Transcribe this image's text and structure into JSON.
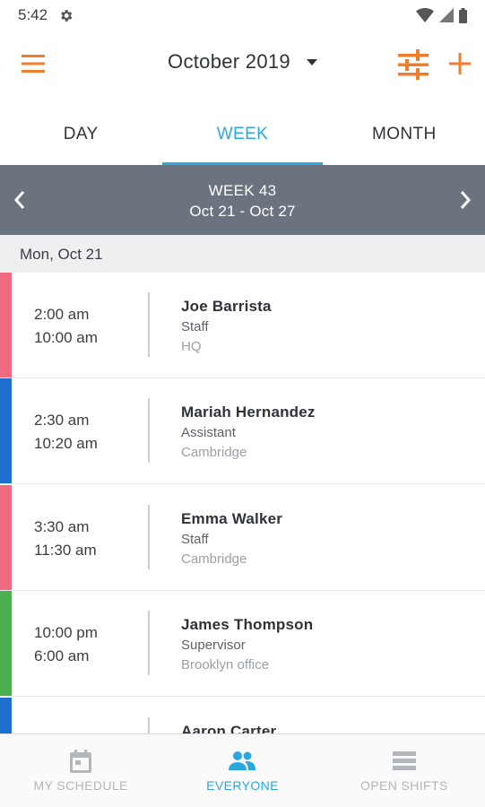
{
  "status_bar": {
    "time": "5:42",
    "icons": [
      "gear-icon",
      "wifi-icon",
      "signal-icon",
      "battery-icon"
    ]
  },
  "app_bar": {
    "menu_icon": "hamburger-menu-icon",
    "month": "October 2019",
    "caret_icon": "caret-down-icon",
    "filter_icon": "sliders-filter-icon",
    "add_icon": "plus-icon",
    "accent_color": "#f07d2b"
  },
  "tabs": [
    {
      "label": "DAY",
      "active": false
    },
    {
      "label": "WEEK",
      "active": true
    },
    {
      "label": "MONTH",
      "active": false
    }
  ],
  "week_nav": {
    "title": "WEEK 43",
    "range": "Oct 21 - Oct 27",
    "prev_icon": "chevron-left-icon",
    "next_icon": "chevron-right-icon"
  },
  "day_header": "Mon, Oct 21",
  "shifts": [
    {
      "start": "2:00 am",
      "end": "10:00 am",
      "name": "Joe Barrista",
      "role": "Staff",
      "location": "HQ",
      "color": "#f06b82"
    },
    {
      "start": "2:30 am",
      "end": "10:20 am",
      "name": "Mariah Hernandez",
      "role": "Assistant",
      "location": "Cambridge",
      "color": "#1f6fd1"
    },
    {
      "start": "3:30 am",
      "end": "11:30 am",
      "name": "Emma Walker",
      "role": "Staff",
      "location": "Cambridge",
      "color": "#f06b82"
    },
    {
      "start": "10:00 pm",
      "end": "6:00 am",
      "name": "James Thompson",
      "role": "Supervisor",
      "location": "Brooklyn office",
      "color": "#4caf50"
    },
    {
      "start": "",
      "end": "",
      "name": "Aaron Carter",
      "role": "",
      "location": "",
      "color": "#1f6fd1"
    }
  ],
  "bottom_nav": [
    {
      "label": "MY SCHEDULE",
      "icon": "calendar-icon",
      "active": false
    },
    {
      "label": "EVERYONE",
      "icon": "people-icon",
      "active": true
    },
    {
      "label": "OPEN SHIFTS",
      "icon": "list-icon",
      "active": false
    }
  ],
  "colors": {
    "accent_blue": "#29a8e0",
    "week_nav_bg": "#6b747e",
    "inactive_nav": "#b3b7bb"
  }
}
